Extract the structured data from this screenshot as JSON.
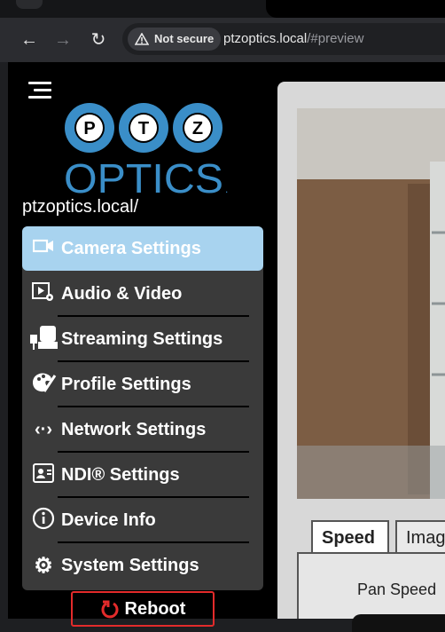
{
  "browser": {
    "nav": {
      "back_icon": "←",
      "forward_icon": "→",
      "reload_icon": "↻"
    },
    "security_label": "Not secure",
    "url_host": "ptzoptics.local",
    "url_path": "/#preview"
  },
  "sidebar": {
    "logo": {
      "letters": [
        "P",
        "T",
        "Z"
      ],
      "wordmark": "OPTICS",
      "reg": "."
    },
    "hostname": "ptzoptics.local/",
    "items": [
      {
        "label": "Camera Settings",
        "icon": "camera-icon",
        "glyph": "▭",
        "active": true
      },
      {
        "label": "Audio & Video",
        "icon": "video-settings-icon",
        "glyph": "▶"
      },
      {
        "label": "Streaming Settings",
        "icon": "streaming-icon",
        "glyph": "🎥"
      },
      {
        "label": "Profile Settings",
        "icon": "palette-icon",
        "glyph": "🎨"
      },
      {
        "label": "Network Settings",
        "icon": "network-icon",
        "glyph": "‹·›"
      },
      {
        "label": "NDI® Settings",
        "icon": "ndi-icon",
        "glyph": "▣"
      },
      {
        "label": "Device Info",
        "icon": "info-icon",
        "glyph": "ⓘ"
      },
      {
        "label": "System Settings",
        "icon": "gear-icon",
        "glyph": "⚙"
      }
    ],
    "reboot_label": "Reboot",
    "reboot_icon": "power-icon"
  },
  "panel": {
    "tabs": [
      "Speed",
      "Imag"
    ],
    "pan_speed_label": "Pan Speed"
  },
  "colors": {
    "accent": "#a8d3ef",
    "reboot_border": "#e32b2b",
    "logo_blue": "#3a8ec8"
  }
}
